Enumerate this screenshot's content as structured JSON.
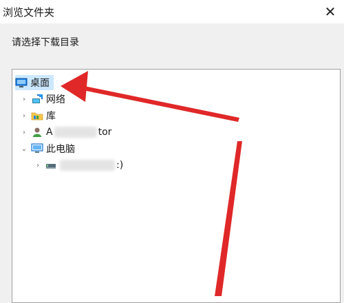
{
  "window": {
    "title": "浏览文件夹",
    "close_glyph": "✕"
  },
  "dialog": {
    "instruction": "请选择下载目录"
  },
  "tree": {
    "items": [
      {
        "label": "桌面",
        "icon": "desktop-icon",
        "selected": true
      },
      {
        "label": "网络",
        "icon": "network-icon",
        "expander": "›"
      },
      {
        "label": "库",
        "icon": "library-icon",
        "expander": "›"
      },
      {
        "label_start": "A",
        "label_end": "tor",
        "icon": "user-icon",
        "expander": "›"
      },
      {
        "label": "此电脑",
        "icon": "computer-icon",
        "expander": "⌄"
      },
      {
        "label_end": ":)",
        "icon": "drive-icon",
        "expander": "›"
      }
    ]
  },
  "colors": {
    "selection": "#cce8ff",
    "arrow": "#e02828"
  }
}
